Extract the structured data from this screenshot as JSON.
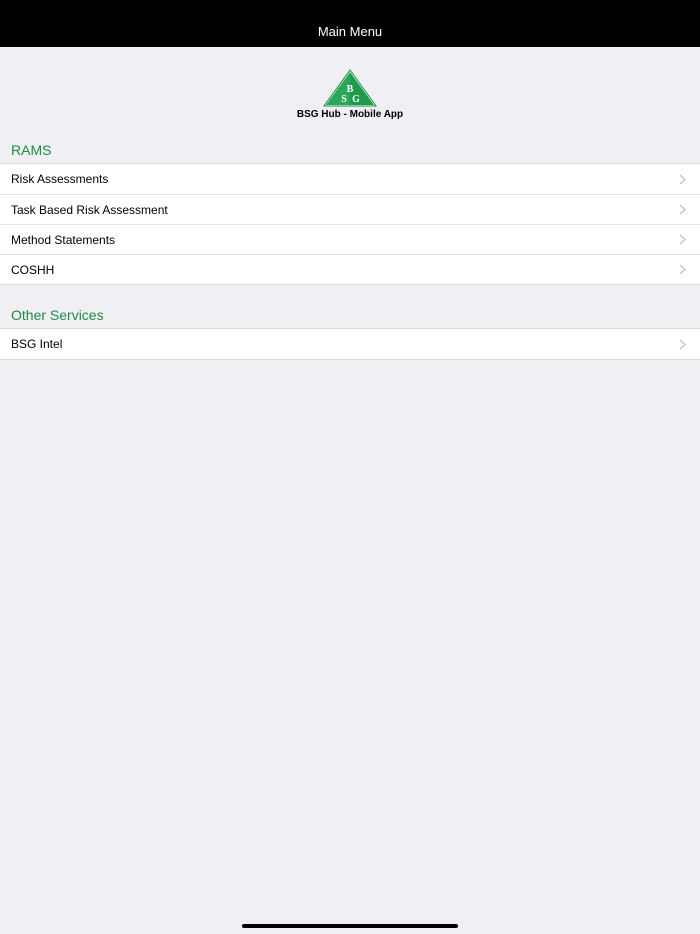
{
  "navbar": {
    "title": "Main Menu"
  },
  "logo": {
    "caption": "BSG Hub - Mobile App",
    "letters": [
      "B",
      "S",
      "G"
    ]
  },
  "sections": [
    {
      "header": "RAMS",
      "items": [
        {
          "label": "Risk Assessments"
        },
        {
          "label": "Task Based Risk Assessment"
        },
        {
          "label": "Method Statements"
        },
        {
          "label": "COSHH"
        }
      ]
    },
    {
      "header": "Other Services",
      "items": [
        {
          "label": "BSG Intel"
        }
      ]
    }
  ],
  "colors": {
    "accent": "#1f8a45",
    "navbar_bg": "#000000",
    "page_bg": "#efeff4"
  }
}
